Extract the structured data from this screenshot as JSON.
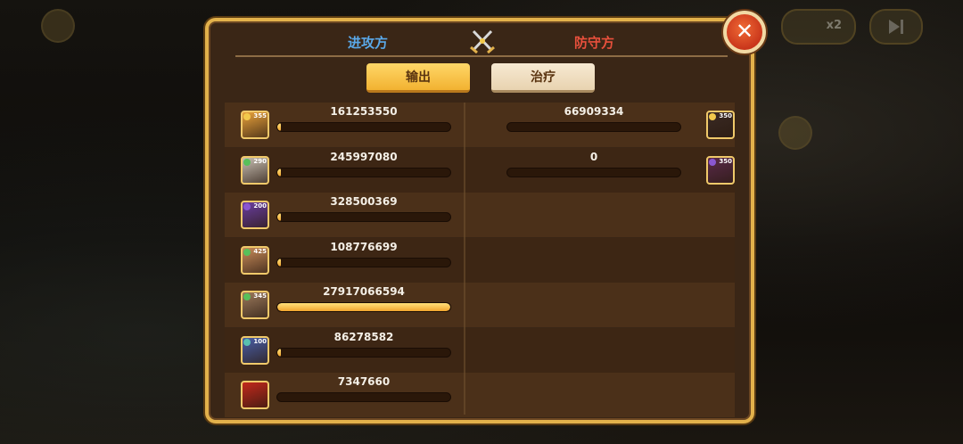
{
  "header": {
    "attacker_label": "进攻方",
    "defender_label": "防守方",
    "center_icon": "crossed-swords-icon"
  },
  "tabs": [
    {
      "label": "输出",
      "active": true
    },
    {
      "label": "治疗",
      "active": false
    }
  ],
  "background": {
    "speed_label": "x2"
  },
  "attackers": [
    {
      "value": "161253550",
      "level": "355",
      "fill_fraction": 0.01,
      "avatar_color": "#e9a23b",
      "orb_color": "#f2c94c"
    },
    {
      "value": "245997080",
      "level": "290",
      "fill_fraction": 0.01,
      "avatar_color": "#c9c0b4",
      "orb_color": "#58c05a"
    },
    {
      "value": "328500369",
      "level": "200",
      "fill_fraction": 0.02,
      "avatar_color": "#6a3ea1",
      "orb_color": "#8a57d1"
    },
    {
      "value": "108776699",
      "level": "425",
      "fill_fraction": 0.01,
      "avatar_color": "#c98c5a",
      "orb_color": "#58c05a"
    },
    {
      "value": "27917066594",
      "level": "345",
      "fill_fraction": 1.0,
      "avatar_color": "#9c7a5c",
      "orb_color": "#58c05a"
    },
    {
      "value": "86278582",
      "level": "100",
      "fill_fraction": 0.01,
      "avatar_color": "#4a5fa8",
      "orb_color": "#58c0b0"
    },
    {
      "value": "7347660",
      "level": "",
      "fill_fraction": 0.0,
      "avatar_color": "#c2281c",
      "orb_color": ""
    }
  ],
  "defenders": [
    {
      "value": "66909334",
      "level": "350",
      "fill_fraction": 0.0,
      "avatar_color": "#3a2a24",
      "orb_color": "#f2c94c"
    },
    {
      "value": "0",
      "level": "350",
      "fill_fraction": 0.0,
      "avatar_color": "#5a2a4a",
      "orb_color": "#8a57d1"
    }
  ],
  "colors": {
    "attacker_header": "#5aa9ea",
    "defender_header": "#e8503c",
    "panel_border": "#e2b14b",
    "bar_fill": "#f0a42e"
  },
  "close_icon": "close-x-icon"
}
